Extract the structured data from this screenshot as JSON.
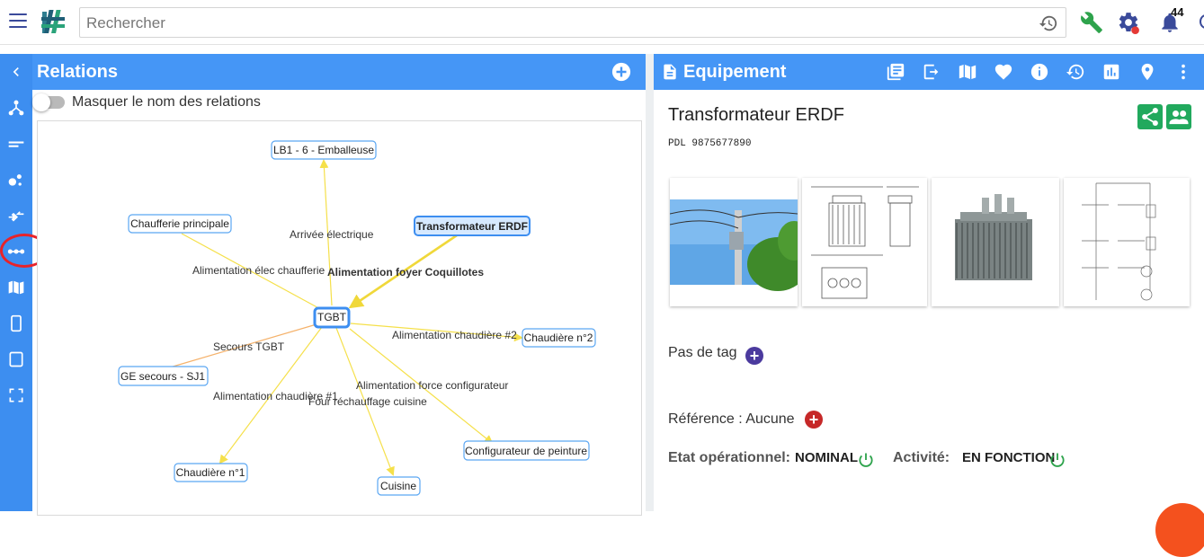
{
  "search": {
    "placeholder": "Rechercher"
  },
  "notifications": {
    "count": "44"
  },
  "relations": {
    "title": "Relations",
    "toggle_label": "Masquer le nom des relations",
    "nodes": {
      "emballeuse": "LB1 - 6 - Emballeuse",
      "chaufferie": "Chaufferie principale",
      "transfo": "Transformateur ERDF",
      "tgbt": "TGBT",
      "chaudiere2": "Chaudière n°2",
      "ge_secours": "GE secours - SJ1",
      "configurateur": "Configurateur de peinture",
      "chaudiere1": "Chaudière n°1",
      "cuisine": "Cuisine"
    },
    "edges": {
      "arrivee": "Arrivée électrique",
      "alim_chaufferie": "Alimentation élec chaufferie",
      "alim_foyer": "Alimentation foyer Coquillotes",
      "alim_chaudiere2": "Alimentation chaudière #2",
      "secours": "Secours TGBT",
      "alim_force": "Alimentation force configurateur",
      "alim_chaudiere1": "Alimentation chaudière #1",
      "four": "Four réchauffage cuisine"
    }
  },
  "equipement": {
    "title": "Equipement",
    "name": "Transformateur ERDF",
    "pdl": "PDL 9875677890",
    "tag_label": "Pas de tag",
    "reference_label": "Référence : Aucune",
    "etat_label": "Etat opérationnel:",
    "etat_value": "NOMINAL",
    "activite_label": "Activité:",
    "activite_value": "EN FONCTION"
  },
  "colors": {
    "accent": "#4596f6",
    "rail": "#3d8ef0",
    "edge": "#f5e04a",
    "edge_orange": "#f5b26b",
    "node_border": "#3d8ef0",
    "green": "#21a95d",
    "red_add": "#c62828",
    "purple_add": "#4b3a9e"
  },
  "icons": [
    "menu-icon",
    "history-icon",
    "wrench-icon",
    "gear-icon",
    "bell-icon",
    "back-chevron-icon",
    "add-circle-icon",
    "hierarchy-icon",
    "list-icon",
    "bubbles-icon",
    "arrows-merge-icon",
    "link-dots-icon",
    "map-icon",
    "phone-icon",
    "tablet-icon",
    "fullscreen-icon",
    "document-icon",
    "library-icon",
    "exit-icon",
    "heart-icon",
    "info-icon",
    "chart-icon",
    "pin-icon",
    "more-vert-icon",
    "share-icon",
    "people-icon",
    "power-icon"
  ]
}
